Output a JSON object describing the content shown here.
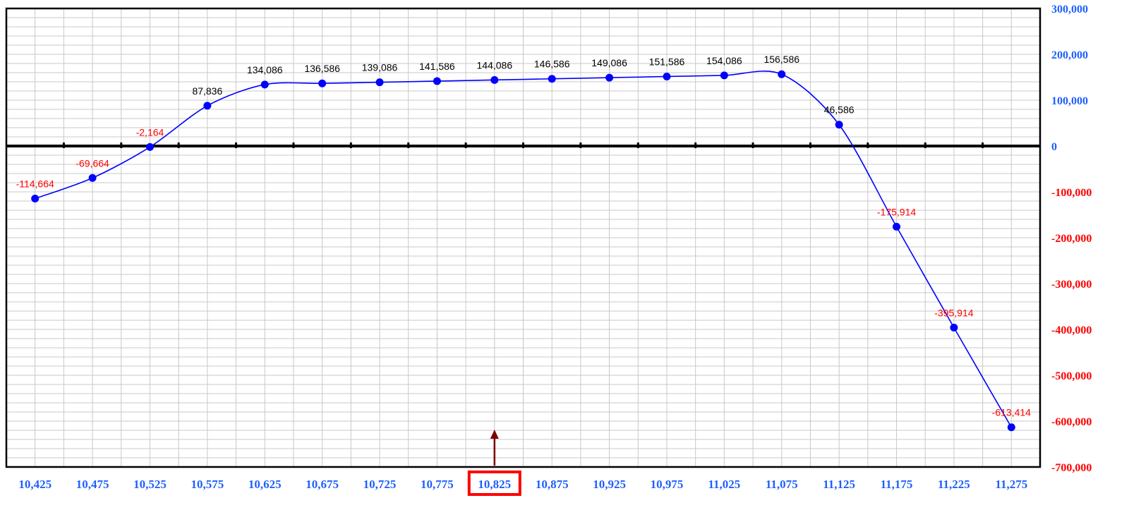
{
  "chart_data": {
    "type": "line",
    "title": "",
    "xlabel": "",
    "ylabel": "",
    "x": [
      "10,425",
      "10,475",
      "10,525",
      "10,575",
      "10,625",
      "10,675",
      "10,725",
      "10,775",
      "10,825",
      "10,875",
      "10,925",
      "10,975",
      "11,025",
      "11,075",
      "11,125",
      "11,175",
      "11,225",
      "11,275"
    ],
    "series": [
      {
        "values": [
          -114664,
          -69664,
          -2164,
          87836,
          134086,
          136586,
          139086,
          141586,
          144086,
          146586,
          149086,
          151586,
          154086,
          156586,
          46586,
          -175914,
          -395914,
          -613414
        ],
        "labels": [
          "-114,664",
          "-69,664",
          "-2,164",
          "87,836",
          "134,086",
          "136,586",
          "139,086",
          "141,586",
          "144,086",
          "146,586",
          "149,086",
          "151,586",
          "154,086",
          "156,586",
          "46,586",
          "-175,914",
          "-395,914",
          "-613,414"
        ]
      }
    ],
    "ylim": [
      -700000,
      300000
    ],
    "yticks": [
      300000,
      200000,
      100000,
      0,
      -100000,
      -200000,
      -300000,
      -400000,
      -500000,
      -600000,
      -700000
    ],
    "ytick_labels": [
      "300,000",
      "200,000",
      "100,000",
      "0",
      "-100,000",
      "-200,000",
      "-300,000",
      "-400,000",
      "-500,000",
      "-600,000",
      "-700,000"
    ],
    "highlighted_x": "10,825",
    "grid": true,
    "colors": {
      "line": "#0000ff",
      "positive_label": "#000000",
      "negative_label": "#ff0000",
      "tick_positive": "#1f5fff",
      "tick_negative": "#ff0000",
      "highlight_box": "#ff0000",
      "arrow": "#7a0000",
      "grid": "#c8c8c8"
    }
  }
}
